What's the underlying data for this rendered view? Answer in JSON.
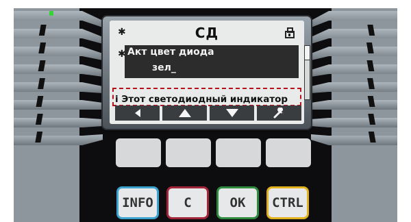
{
  "screen": {
    "title": "СД",
    "star_top": "✱",
    "star_param": "✱",
    "parameter_label": "Акт цвет диода",
    "parameter_value": "зел_",
    "info_text": "i Этот светодиодный индикатор",
    "softkeys": {
      "left_icon": "arrow-left-icon",
      "up_icon": "arrow-up-icon",
      "down_icon": "arrow-down-icon",
      "wrench_icon": "wrench-icon"
    }
  },
  "buttons": {
    "info": "INFO",
    "c": "C",
    "ok": "OK",
    "ctrl": "CTRL"
  },
  "colors": {
    "info_border": "#3aa3cf",
    "c_border": "#a3253a",
    "ok_border": "#2e8a3f",
    "ctrl_border": "#e2b21f",
    "highlight": "#b5121b",
    "led": "#38d23a"
  }
}
